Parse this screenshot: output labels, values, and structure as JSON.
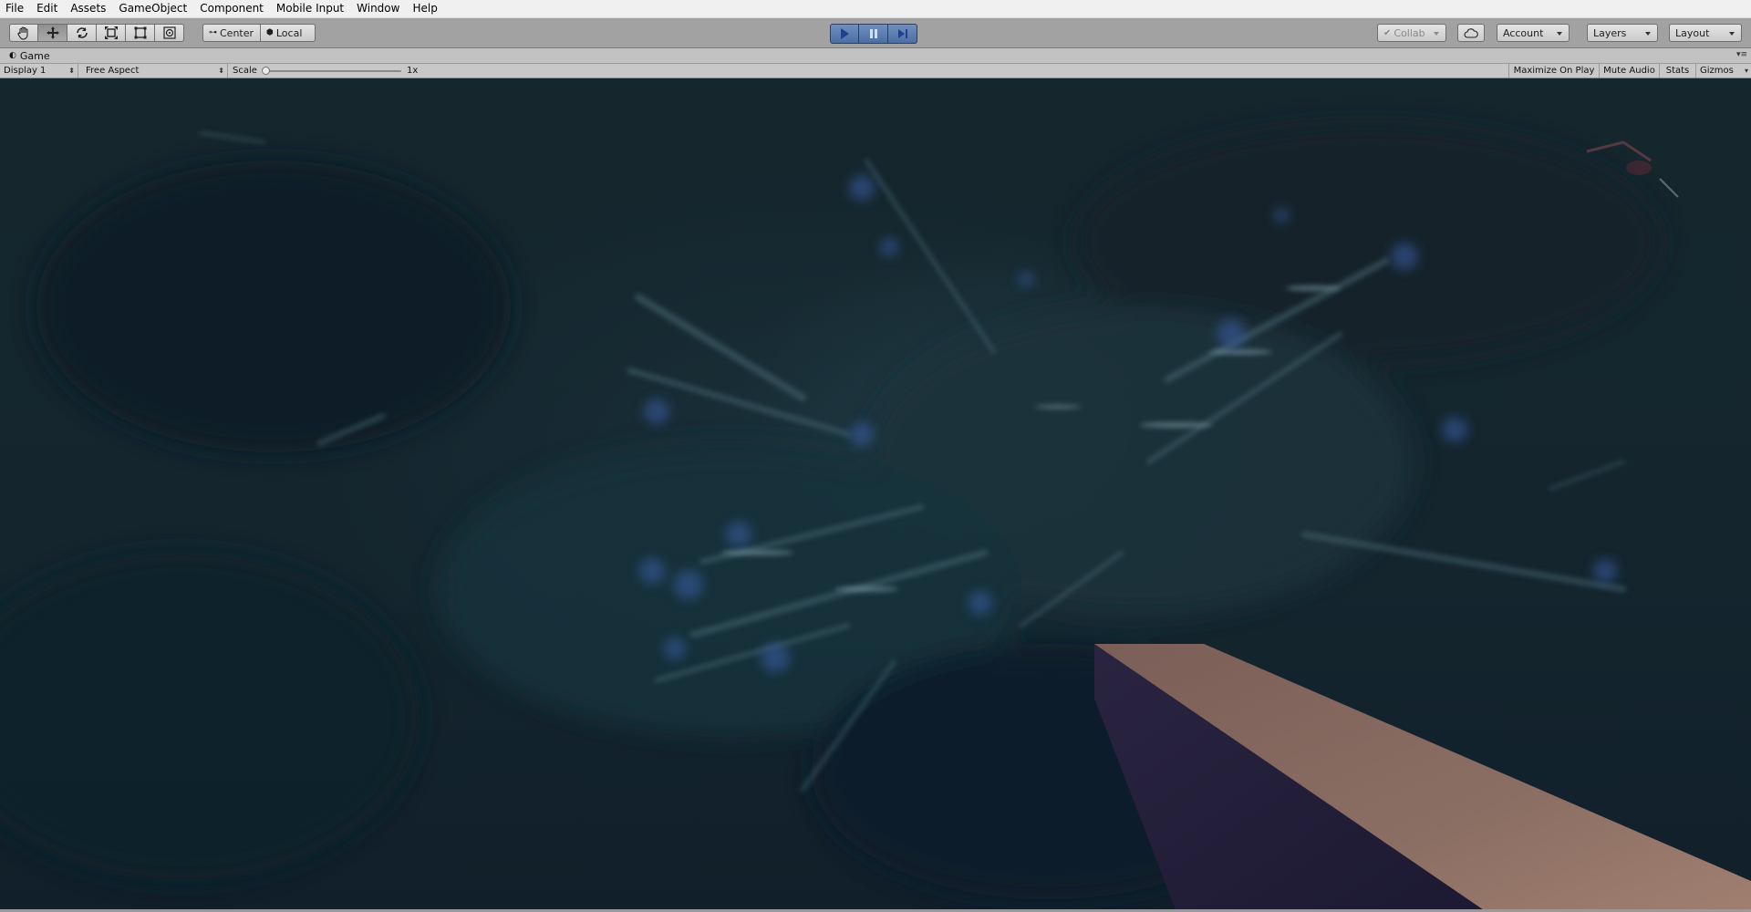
{
  "menu": [
    "File",
    "Edit",
    "Assets",
    "GameObject",
    "Component",
    "Mobile Input",
    "Window",
    "Help"
  ],
  "toolbar": {
    "tools": [
      "hand-icon",
      "move-icon",
      "rotate-icon",
      "scale-icon",
      "rect-icon",
      "transform-icon"
    ],
    "active_tool": "move-icon",
    "pivot_center": "Center",
    "pivot_local": "Local",
    "collab": "Collab",
    "account": "Account",
    "layers": "Layers",
    "layout": "Layout"
  },
  "tab": {
    "title": "Game"
  },
  "game_bar": {
    "display": "Display 1",
    "aspect": "Free Aspect",
    "scale_label": "Scale",
    "scale_value": "1x",
    "scale_level": 1,
    "maximize": "Maximize On Play",
    "mute": "Mute Audio",
    "stats": "Stats",
    "gizmos": "Gizmos"
  },
  "colors": {
    "play_active": "#5a7bb0",
    "viewport_bg": "#15262d",
    "plank_top": "#8a6e64",
    "plank_side": "#241f3a"
  }
}
